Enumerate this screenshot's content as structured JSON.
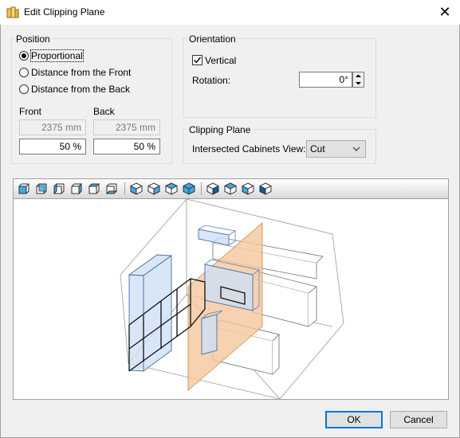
{
  "window": {
    "title": "Edit Clipping Plane",
    "close_glyph": "✕",
    "icon": "clipping-plane-app-icon"
  },
  "position": {
    "group_label": "Position",
    "options": [
      "Proportional",
      "Distance from the Front",
      "Distance from the Back"
    ],
    "selected": "Proportional",
    "front_label": "Front",
    "back_label": "Back",
    "front_mm": "2375 mm",
    "back_mm": "2375 mm",
    "front_pct": "50 %",
    "back_pct": "50 %"
  },
  "orientation": {
    "group_label": "Orientation",
    "vertical_label": "Vertical",
    "vertical_checked": true,
    "rotation_label": "Rotation:",
    "rotation_value": "0°"
  },
  "clipping_plane": {
    "group_label": "Clipping Plane",
    "intersected_label": "Intersected Cabinets View:",
    "intersected_value": "Cut"
  },
  "viewer": {
    "toolbar_icons": [
      "view-front-icon",
      "view-back-icon",
      "view-left-icon",
      "view-right-icon",
      "view-top-icon",
      "view-bottom-icon",
      "iso-view-1-icon",
      "iso-view-2-icon",
      "iso-view-3-icon",
      "iso-view-4-icon",
      "iso-view-5-icon",
      "iso-view-6-icon",
      "iso-view-7-icon",
      "iso-view-8-icon"
    ],
    "plane_color": "#f4c79c",
    "cabinet_color": "#cfe0f5"
  },
  "buttons": {
    "ok": "OK",
    "cancel": "Cancel"
  },
  "colors": {
    "accent": "#0078d7"
  }
}
